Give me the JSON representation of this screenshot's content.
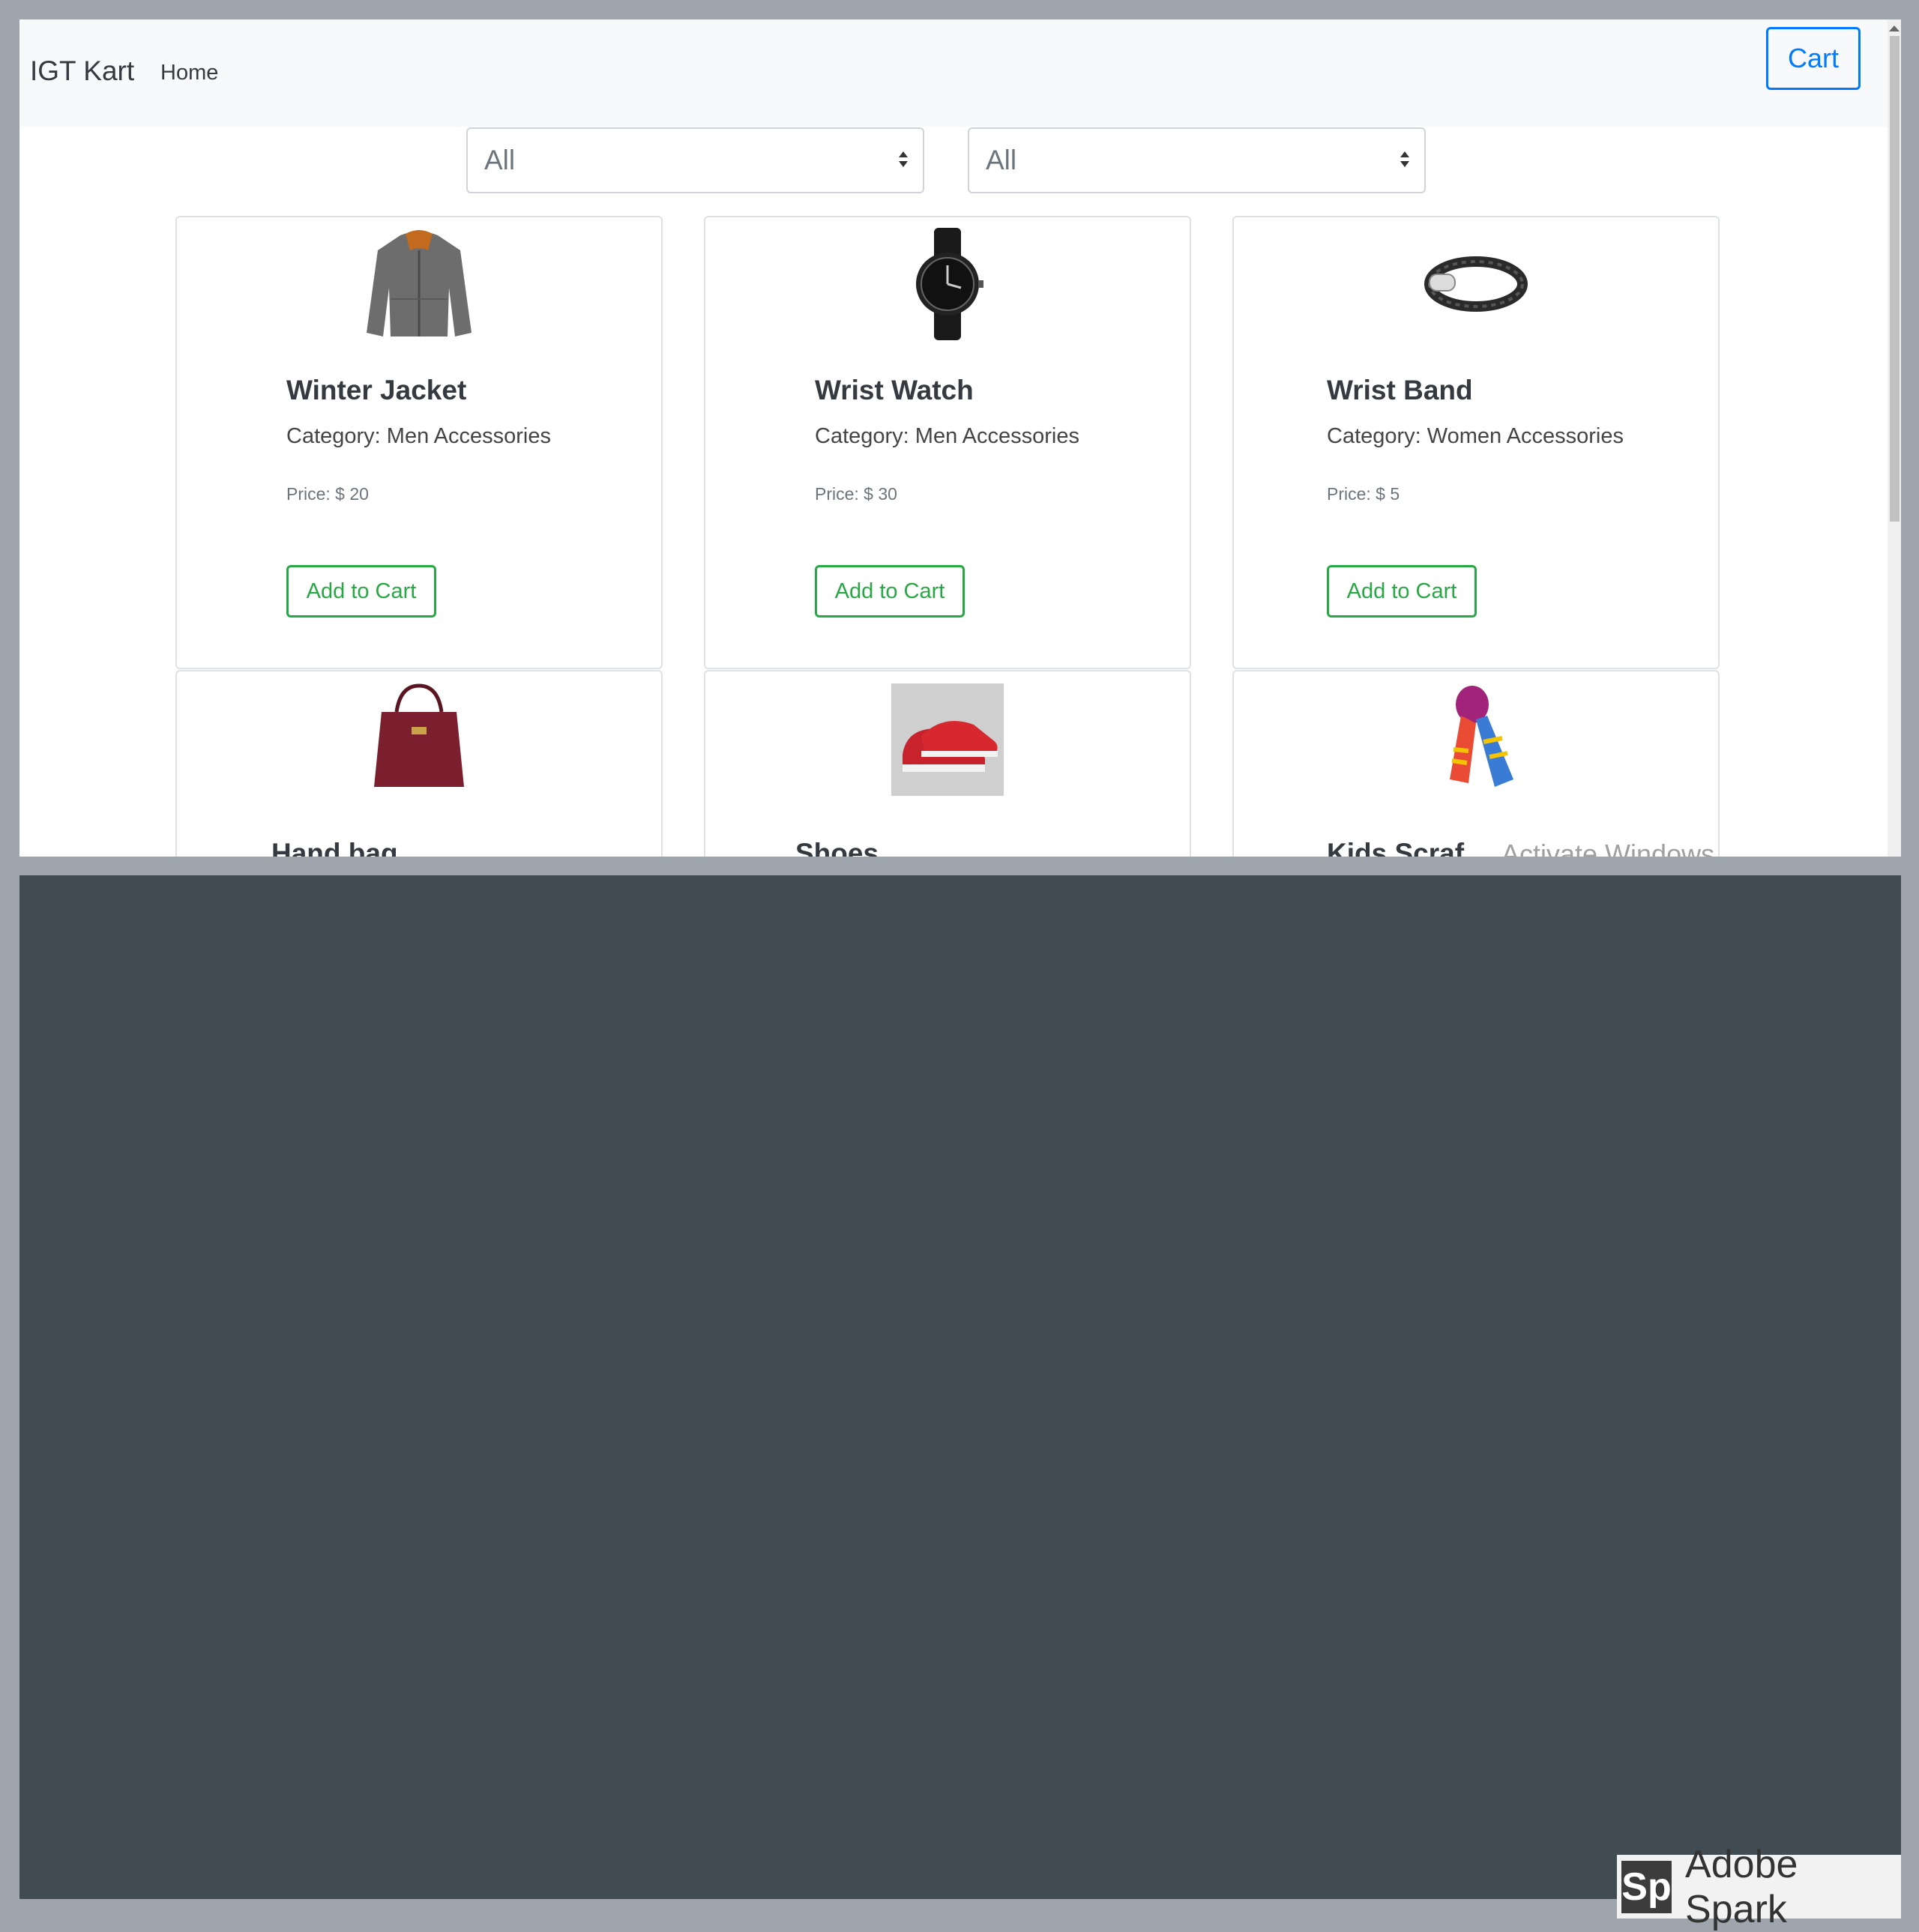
{
  "navbar": {
    "brand": "IGT Kart",
    "home": "Home",
    "cart": "Cart"
  },
  "filters": [
    {
      "selected": "All"
    },
    {
      "selected": "All"
    }
  ],
  "products": [
    {
      "title": "Winter Jacket",
      "category": "Category: Men Accessories",
      "price": "Price: $ 20",
      "button": "Add to Cart",
      "icon": "jacket-icon"
    },
    {
      "title": "Wrist Watch",
      "category": "Category: Men Accessories",
      "price": "Price: $ 30",
      "button": "Add to Cart",
      "icon": "watch-icon"
    },
    {
      "title": "Wrist Band",
      "category": "Category: Women Accessories",
      "price": "Price: $ 5",
      "button": "Add to Cart",
      "icon": "bracelet-icon"
    },
    {
      "title": "Hand bag",
      "icon": "handbag-icon"
    },
    {
      "title": "Shoes",
      "icon": "shoes-icon"
    },
    {
      "title": "Kids Scraf",
      "icon": "scarf-icon"
    }
  ],
  "watermark": "Activate Windows",
  "branding": {
    "logo": "Sp",
    "name": "Adobe Spark"
  },
  "colors": {
    "primary": "#007bff",
    "success": "#28a745",
    "panel": "#404b52",
    "frame": "#9ea5ad"
  }
}
